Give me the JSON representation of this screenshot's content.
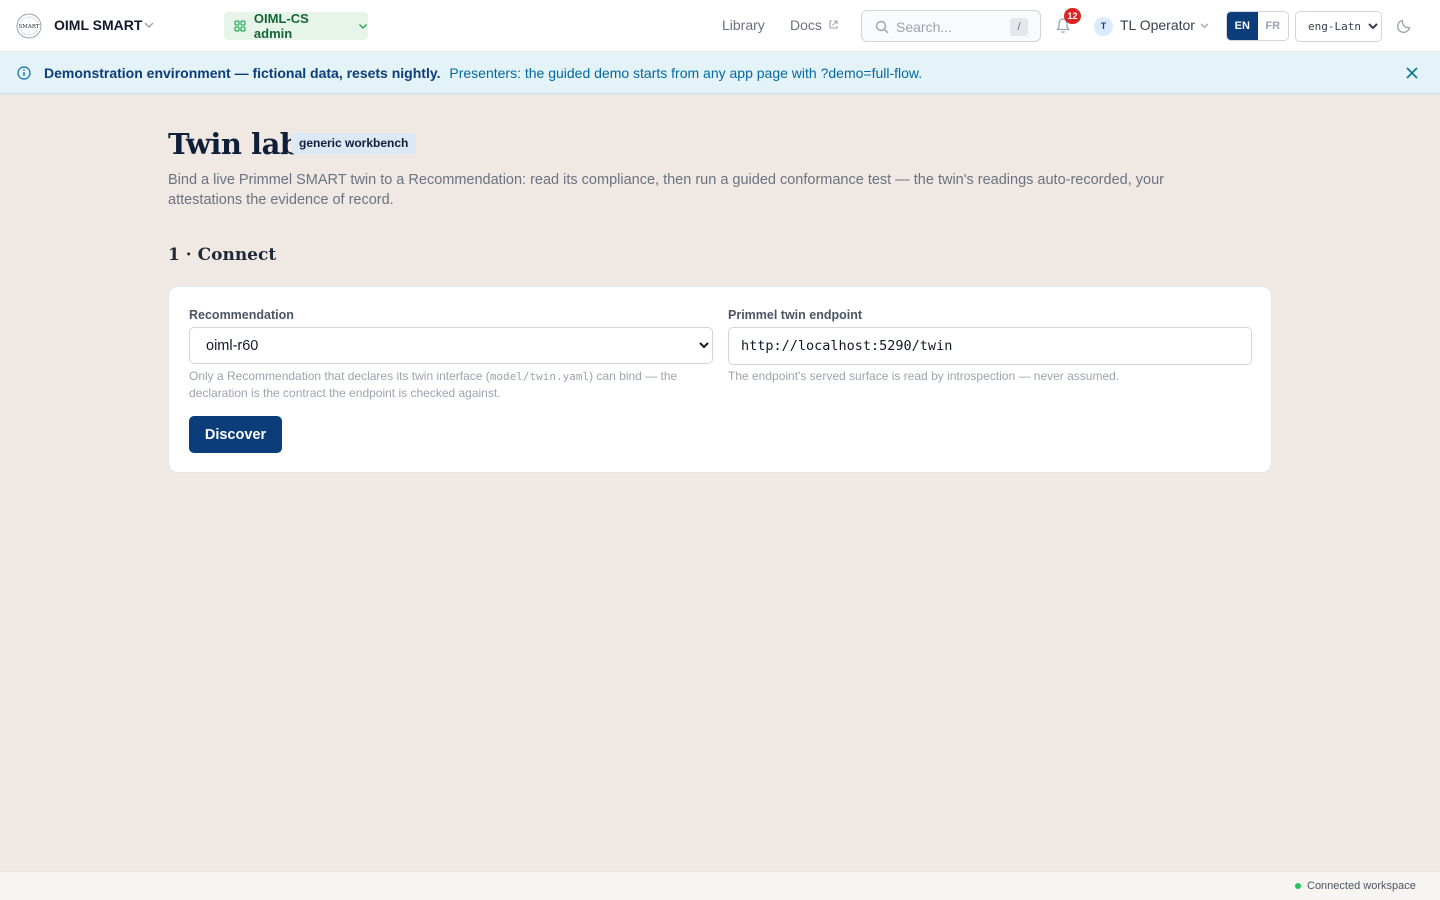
{
  "header": {
    "app_name": "OIML SMART",
    "workspace_label": "OIML-CS admin",
    "nav": [
      "Library",
      "Docs"
    ],
    "search_placeholder": "Search...",
    "search_shortcut": "/",
    "notification_count": "12",
    "user_initial": "T",
    "user_name": "TL Operator",
    "languages": [
      "EN",
      "FR"
    ],
    "active_language": "EN",
    "script_value": "eng-Latn"
  },
  "banner": {
    "strong": "Demonstration environment — fictional data, resets nightly.",
    "note": "Presenters: the guided demo starts from any app page with ?demo=full-flow."
  },
  "main": {
    "title": "Twin lab",
    "tag": "generic workbench",
    "lead": "Bind a live Primmel SMART twin to a Recommendation: read its compliance, then run a guided conformance test — the twin's readings auto-recorded, your attestations the evidence of record.",
    "section_title": "1 · Connect",
    "recommendation": {
      "label": "Recommendation",
      "value": "oiml-r60",
      "help_before": "Only a Recommendation that declares its twin interface (",
      "help_code": "model/twin.yaml",
      "help_after": ") can bind — the declaration is the contract the endpoint is checked against."
    },
    "endpoint": {
      "label": "Primmel twin endpoint",
      "value": "http://localhost:5290/twin",
      "help": "The endpoint's served surface is read by introspection — never assumed."
    },
    "discover_label": "Discover"
  },
  "footer": {
    "status": "Connected workspace"
  },
  "colors": {
    "brand": "#0b3d7a",
    "page_bg": "#f0e9e3",
    "banner_bg": "#e4f3f8",
    "badge": "#dc2626",
    "status_ok": "#22c55e"
  }
}
